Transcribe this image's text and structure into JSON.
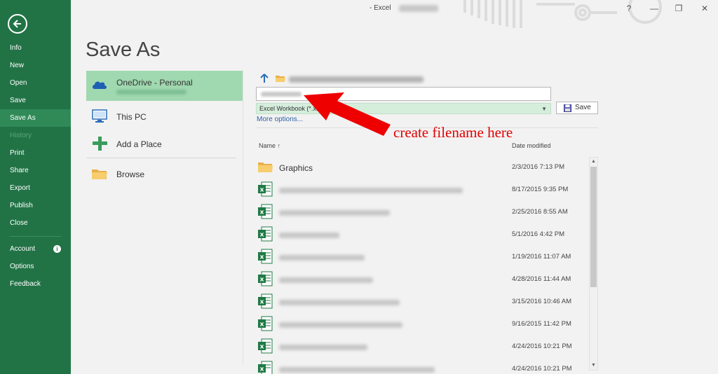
{
  "window": {
    "title_suffix": "- Excel",
    "controls": [
      "?",
      "—",
      "❐",
      "✕"
    ]
  },
  "nav": {
    "back_icon": "back-arrow-icon",
    "items": [
      {
        "label": "Info",
        "state": "normal"
      },
      {
        "label": "New",
        "state": "normal"
      },
      {
        "label": "Open",
        "state": "normal"
      },
      {
        "label": "Save",
        "state": "normal"
      },
      {
        "label": "Save As",
        "state": "active"
      },
      {
        "label": "History",
        "state": "disabled"
      },
      {
        "label": "Print",
        "state": "normal"
      },
      {
        "label": "Share",
        "state": "normal"
      },
      {
        "label": "Export",
        "state": "normal"
      },
      {
        "label": "Publish",
        "state": "normal"
      },
      {
        "label": "Close",
        "state": "normal"
      }
    ],
    "bottom_items": [
      {
        "label": "Account"
      },
      {
        "label": "Options"
      },
      {
        "label": "Feedback"
      }
    ],
    "info_glyph": "i"
  },
  "page": {
    "title": "Save As"
  },
  "locations": [
    {
      "label": "OneDrive - Personal",
      "icon": "cloud-icon",
      "active": true
    },
    {
      "label": "This PC",
      "icon": "computer-icon",
      "active": false
    },
    {
      "label": "Add a Place",
      "icon": "plus-icon",
      "active": false
    },
    {
      "label": "Browse",
      "icon": "folder-icon",
      "active": false
    }
  ],
  "save_panel": {
    "file_type": "Excel Workbook (*.xlsx)",
    "save_label": "Save",
    "more_options": "More options...",
    "columns": {
      "name": "Name ↑",
      "date": "Date modified"
    }
  },
  "files": [
    {
      "name": "Graphics",
      "type": "folder",
      "date": "2/3/2016 7:13 PM"
    },
    {
      "name": "",
      "type": "excel",
      "date": "8/17/2015 9:35 PM"
    },
    {
      "name": "",
      "type": "excel",
      "date": "2/25/2016 8:55 AM"
    },
    {
      "name": "",
      "type": "excel",
      "date": "5/1/2016 4:42 PM"
    },
    {
      "name": "",
      "type": "excel",
      "date": "1/19/2016 11:07 AM"
    },
    {
      "name": "",
      "type": "excel",
      "date": "4/28/2016 11:44 AM"
    },
    {
      "name": "",
      "type": "excel",
      "date": "3/15/2016 10:46 AM"
    },
    {
      "name": "",
      "type": "excel",
      "date": "9/16/2015 11:42 PM"
    },
    {
      "name": "",
      "type": "excel",
      "date": "4/24/2016 10:21 PM"
    },
    {
      "name": "",
      "type": "excel",
      "date": "4/24/2016 10:21 PM"
    }
  ],
  "annotation": {
    "text": "create filename here",
    "color": "#e30000"
  },
  "colors": {
    "nav_bg": "#217346",
    "active_location": "#a0d8b0",
    "file_type_bg": "#d5eedc",
    "link": "#2f5fa6"
  }
}
